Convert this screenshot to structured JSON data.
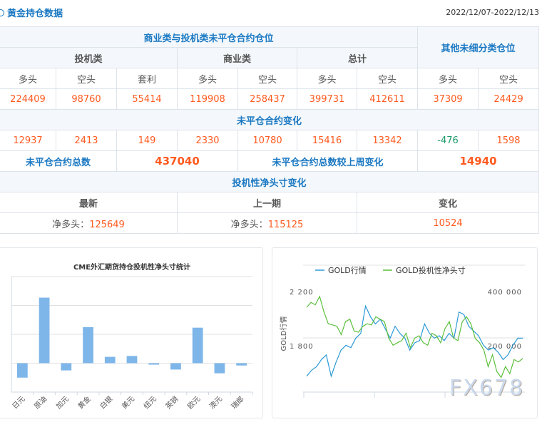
{
  "header": {
    "title": "黄金持仓数据",
    "date_range": "2022/12/07-2022/12/13"
  },
  "table": {
    "group1": "商业类与投机类未平仓合约仓位",
    "group2": "其他未细分类仓位",
    "sub": [
      "投机类",
      "商业类",
      "总计"
    ],
    "cols": [
      "多头",
      "空头",
      "套利",
      "多头",
      "空头",
      "多头",
      "空头",
      "多头",
      "空头"
    ],
    "values": [
      "224409",
      "98760",
      "55414",
      "119908",
      "258437",
      "399731",
      "412611",
      "37309",
      "24429"
    ],
    "change_title": "未平仓合约变化",
    "changes": [
      "12937",
      "2413",
      "149",
      "2330",
      "10780",
      "15416",
      "13342",
      "-476",
      "1598"
    ],
    "total_label": "未平仓合约总数",
    "total": "437040",
    "total_change_label": "未平仓合约总数较上周变化",
    "total_change": "14940",
    "net_title": "投机性净头寸变化",
    "net_cols": [
      "最新",
      "上一期",
      "变化"
    ],
    "net_prefix": "净多头：",
    "net_latest": "125649",
    "net_prev": "115125",
    "net_change": "10524"
  },
  "chart_data": [
    {
      "type": "bar",
      "title": "CME外汇期货持仓投机性净头寸统计",
      "categories": [
        "日元",
        "原油",
        "加元",
        "黄金",
        "白银",
        "美元",
        "纽元",
        "英镑",
        "欧元",
        "澳元",
        "瑞郎"
      ],
      "values": [
        -0.5,
        2.27,
        -0.25,
        1.25,
        0.22,
        0.25,
        -0.05,
        -0.22,
        1.23,
        -0.35,
        -0.08
      ],
      "ylim": [
        -1,
        3
      ],
      "color": "#7eb6ea"
    },
    {
      "type": "line",
      "legend": [
        "GOLD行情",
        "GOLD投机性净头寸"
      ],
      "ylabel": "GOLD行情",
      "left_ticks": [
        "2 200",
        "1 800"
      ],
      "right_ticks": [
        "400 000",
        "200 000"
      ],
      "left_lim": [
        1400,
        2200
      ],
      "right_lim": [
        0,
        400000
      ],
      "series": [
        {
          "name": "GOLD行情",
          "color": "#2b9ad6",
          "axis": "left",
          "values": [
            1517,
            1561,
            1587,
            1640,
            1675,
            1517,
            1622,
            1710,
            1745,
            1728,
            1798,
            1833,
            2035,
            1956,
            1903,
            1938,
            1868,
            1798,
            1886,
            1833,
            1798,
            1710,
            1763,
            1780,
            1903,
            1833,
            1798,
            1816,
            1780,
            1833,
            1798,
            1991,
            1973,
            1886,
            1851,
            1816,
            1745,
            1710,
            1728,
            1693,
            1640,
            1675,
            1745,
            1798,
            1798
          ]
        },
        {
          "name": "GOLD投机性净头寸",
          "color": "#5cbf3c",
          "axis": "right",
          "values": [
            313000,
            331000,
            322000,
            353000,
            296000,
            252000,
            248000,
            243000,
            212000,
            260000,
            269000,
            225000,
            221000,
            243000,
            252000,
            248000,
            278000,
            269000,
            260000,
            199000,
            173000,
            182000,
            190000,
            217000,
            164000,
            199000,
            208000,
            182000,
            173000,
            217000,
            208000,
            182000,
            234000,
            260000,
            199000,
            190000,
            260000,
            278000,
            252000,
            199000,
            182000,
            155000,
            94000,
            138000,
            76000,
            54000,
            94000,
            68000,
            120000,
            111000,
            124000
          ]
        }
      ]
    }
  ],
  "watermark": "FX678"
}
